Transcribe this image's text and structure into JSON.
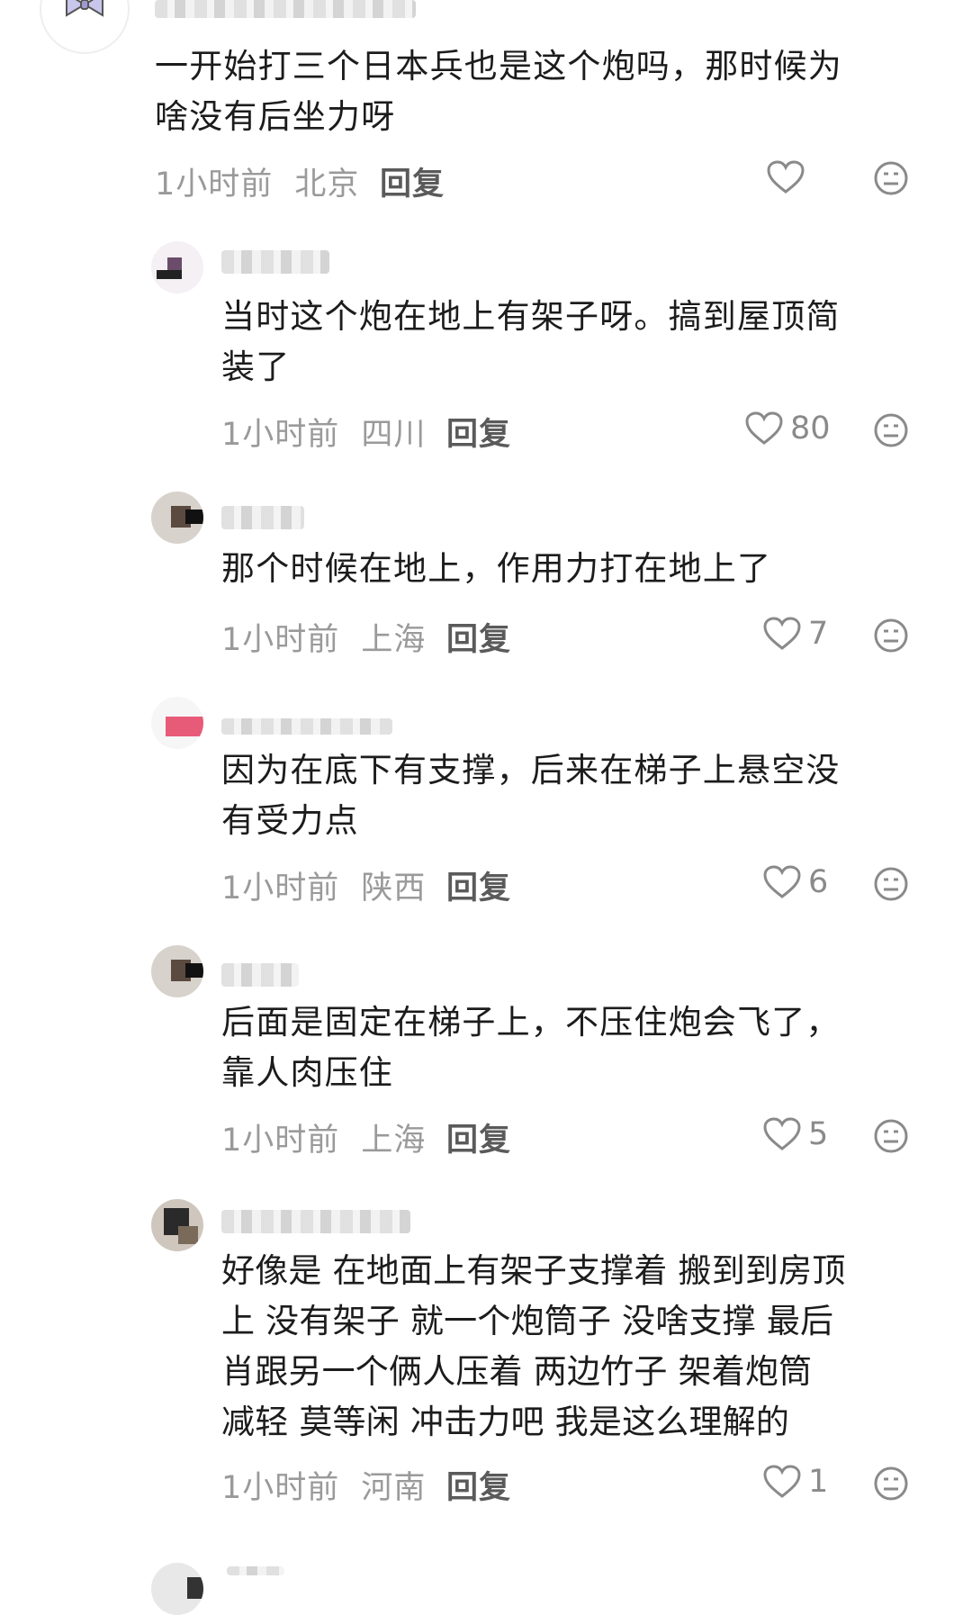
{
  "comments": [
    {
      "text": "一开始打三个日本兵也是这个炮吗，那时候为\n啥没有后坐力呀",
      "time": "1小时前",
      "location": "北京",
      "reply_label": "回复",
      "likes": ""
    },
    {
      "text": "当时这个炮在地上有架子呀。搞到屋顶简\n装了",
      "time": "1小时前",
      "location": "四川",
      "reply_label": "回复",
      "likes": "80"
    },
    {
      "text": "那个时候在地上，作用力打在地上了",
      "time": "1小时前",
      "location": "上海",
      "reply_label": "回复",
      "likes": "7"
    },
    {
      "text": "因为在底下有支撑，后来在梯子上悬空没\n有受力点",
      "time": "1小时前",
      "location": "陕西",
      "reply_label": "回复",
      "likes": "6"
    },
    {
      "text": "后面是固定在梯子上，不压住炮会飞了，\n靠人肉压住",
      "time": "1小时前",
      "location": "上海",
      "reply_label": "回复",
      "likes": "5"
    },
    {
      "text": "好像是 在地面上有架子支撑着 搬到到房顶\n上 没有架子 就一个炮筒子 没啥支撑 最后\n肖跟另一个俩人压着 两边竹子 架着炮筒\n减轻 莫等闲 冲击力吧 我是这么理解的",
      "time": "1小时前",
      "location": "河南",
      "reply_label": "回复",
      "likes": "1"
    }
  ],
  "icons": {
    "like": "heart-icon",
    "dislike": "dislike-face-icon",
    "avatar_main": "bow-avatar-icon"
  }
}
